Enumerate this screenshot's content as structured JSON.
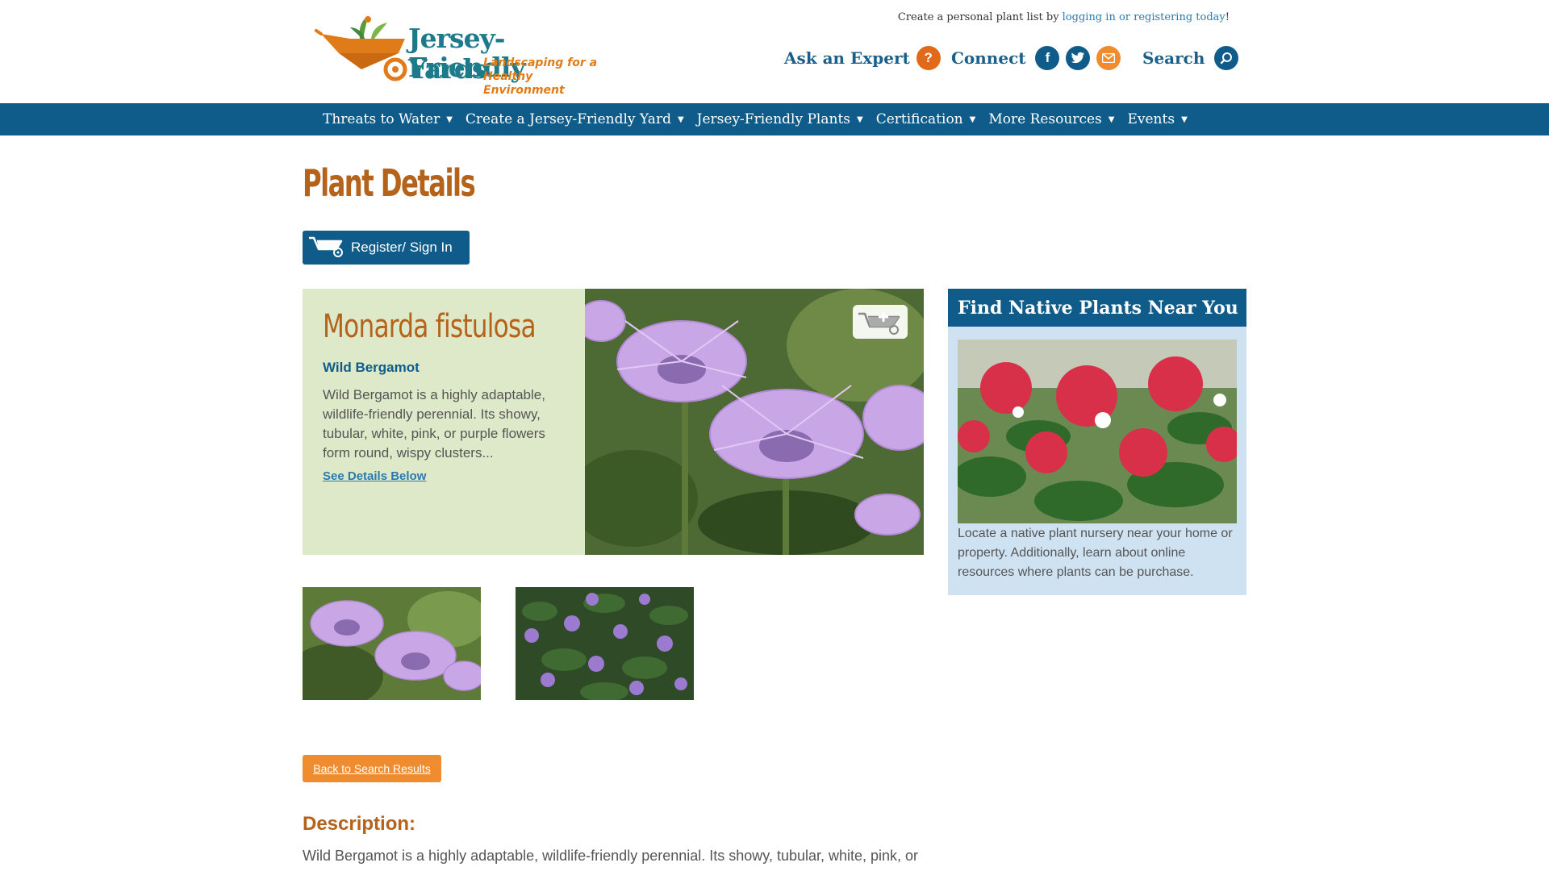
{
  "site": {
    "logo": {
      "title_line1": "Jersey-Friendly",
      "title_line2": "Yards",
      "tagline": "Landscaping for a Healthy Environment"
    },
    "plant_list_prompt": "Create a personal plant list by ",
    "plant_list_link": "logging in or registering today",
    "plant_list_suffix": "!"
  },
  "utility": {
    "ask_expert": "Ask an Expert",
    "connect": "Connect",
    "search": "Search"
  },
  "nav": {
    "items": [
      {
        "label": "Threats to Water"
      },
      {
        "label": "Create a Jersey-Friendly Yard"
      },
      {
        "label": "Jersey-Friendly Plants"
      },
      {
        "label": "Certification"
      },
      {
        "label": "More Resources"
      },
      {
        "label": "Events"
      }
    ]
  },
  "page": {
    "title": "Plant Details",
    "register_label": "Register/ Sign In"
  },
  "plant": {
    "scientific_name": "Monarda fistulosa",
    "common_name": "Wild Bergamot",
    "summary": "Wild Bergamot is a highly adaptable, wildlife-friendly perennial. Its showy, tubular, white, pink, or purple flowers form round, wispy clusters...",
    "see_details": "See Details Below",
    "back_label": "Back to Search Results",
    "description_heading": "Description:",
    "description_text": "Wild Bergamot is a highly adaptable, wildlife-friendly perennial. Its showy, tubular, white, pink, or"
  },
  "sidebar": {
    "heading": "Find Native Plants Near You",
    "text": "Locate a native plant nursery near your home or property. Additionally, learn about online resources where plants can be purchase."
  },
  "icons": {
    "ask": "question-icon",
    "facebook": "facebook-icon",
    "twitter": "twitter-icon",
    "email": "email-icon",
    "search": "search-icon",
    "cart": "wheelbarrow-icon"
  },
  "colors": {
    "brand_blue": "#0f5c8a",
    "brand_orange": "#b5621a",
    "button_orange": "#f08c30",
    "card_green": "#dde9c8",
    "sidebar_blue": "#cfe2f2"
  }
}
